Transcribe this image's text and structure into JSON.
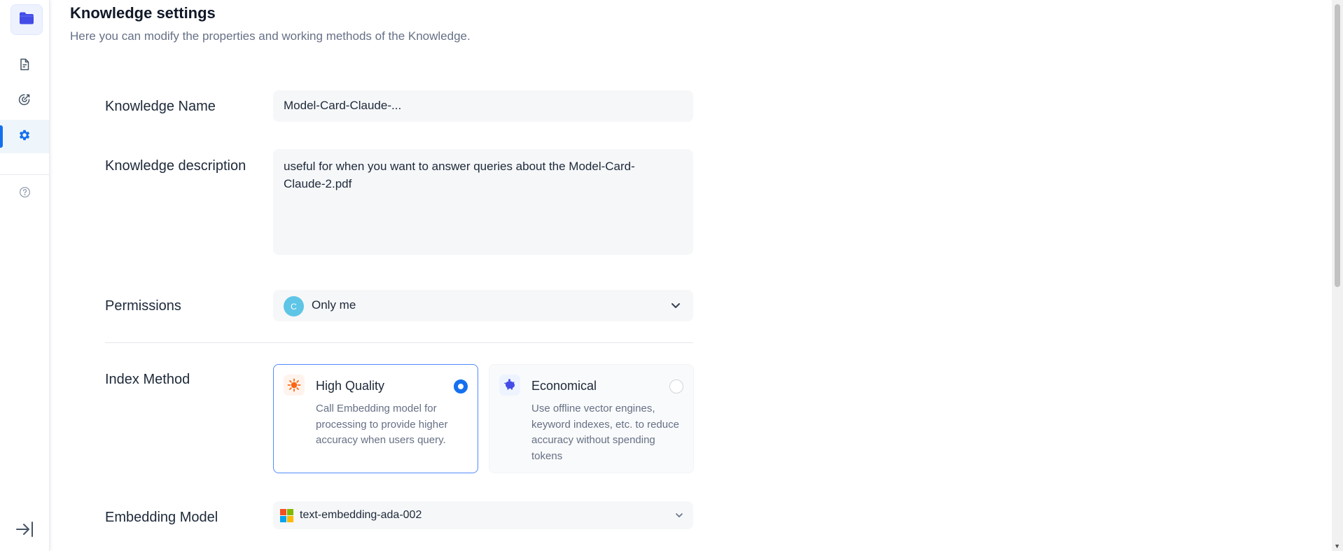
{
  "header": {
    "title": "Knowledge settings",
    "description": "Here you can modify the properties and working methods of the Knowledge."
  },
  "sidebar": {
    "logo_icon": "folder-icon",
    "items": [
      {
        "name": "documents",
        "icon": "document-icon",
        "active": false
      },
      {
        "name": "hit-testing",
        "icon": "target-icon",
        "active": false
      },
      {
        "name": "settings",
        "icon": "gear-icon",
        "active": true
      },
      {
        "name": "help",
        "icon": "help-circle-icon",
        "active": false
      }
    ],
    "collapse_icon": "collapse-sidebar-icon"
  },
  "form": {
    "name": {
      "label": "Knowledge Name",
      "value": "Model-Card-Claude-..."
    },
    "description": {
      "label": "Knowledge description",
      "value": "useful for when you want to answer queries about the Model-Card-Claude-2.pdf"
    },
    "permissions": {
      "label": "Permissions",
      "avatar_letter": "C",
      "value": "Only me"
    },
    "index_method": {
      "label": "Index Method",
      "options": [
        {
          "title": "High Quality",
          "description": "Call Embedding model for processing to provide higher accuracy when users query.",
          "selected": true,
          "icon": "sun-icon"
        },
        {
          "title": "Economical",
          "description": "Use offline vector engines, keyword indexes, etc. to reduce accuracy without spending tokens",
          "selected": false,
          "icon": "piggy-bank-icon"
        }
      ]
    },
    "embedding_model": {
      "label": "Embedding Model",
      "value": "text-embedding-ada-002",
      "provider_icon": "microsoft-logo-icon"
    }
  },
  "colors": {
    "accent": "#1570ef",
    "selected_border": "#528bff",
    "field_bg": "#f6f7f9",
    "avatar": "#5ec5e6"
  }
}
